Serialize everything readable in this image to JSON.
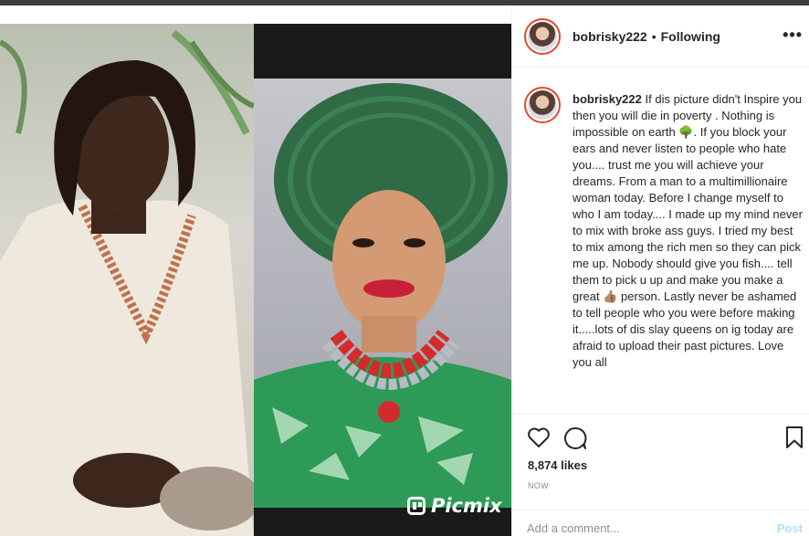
{
  "post": {
    "username": "bobrisky222",
    "separator": "•",
    "follow_status": "Following",
    "more_icon": "more-horizontal-icon",
    "caption_text": "If dis picture didn't Inspire you then you will die in poverty . Nothing is impossible on earth 🌳. If you block your ears and never listen to people who hate you.... trust me you will achieve your dreams. From a man to a multimillionaire woman today. Before I change myself to who I am today.... I made up my mind never to mix with broke ass guys. I tried my best to mix among the rich men so they can pick me up. Nobody should give you fish.... tell them to pick u up and make you make a great 👍🏽 person. Lastly never be ashamed to tell people who you were before making it.....lots of dis slay queens on ig today are afraid to upload their past pictures. Love you all",
    "likes": "8,874 likes",
    "time": "NOW",
    "comment_placeholder": "Add a comment...",
    "post_label": "Post"
  },
  "image": {
    "watermark": "Picmix"
  },
  "colors": {
    "avatar_ring": "#e0492f",
    "post_button": "#b2dffc",
    "secondary_text": "#8e8e8e"
  }
}
